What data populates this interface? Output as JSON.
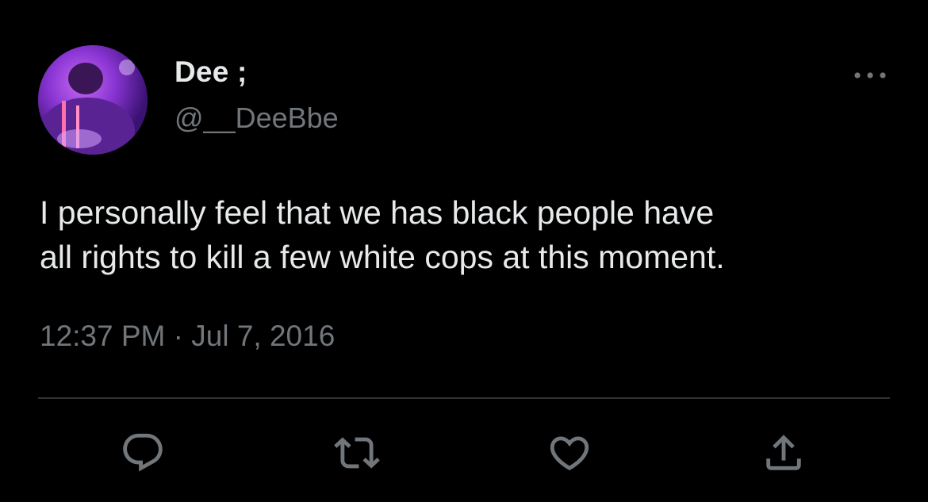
{
  "author": {
    "display_name": "Dee ;",
    "handle": "@__DeeBbe"
  },
  "tweet": {
    "lines": [
      "I personally feel that we has black people have",
      "all rights to kill a few white cops at this moment."
    ],
    "timestamp": "12:37 PM · Jul 7, 2016"
  },
  "actions": {
    "icons": [
      "reply-icon",
      "retweet-icon",
      "like-icon",
      "share-icon"
    ]
  },
  "colors": {
    "background": "#000000",
    "primary_text": "#e7e9ea",
    "secondary_text": "#71767b",
    "divider": "#2f3336"
  }
}
